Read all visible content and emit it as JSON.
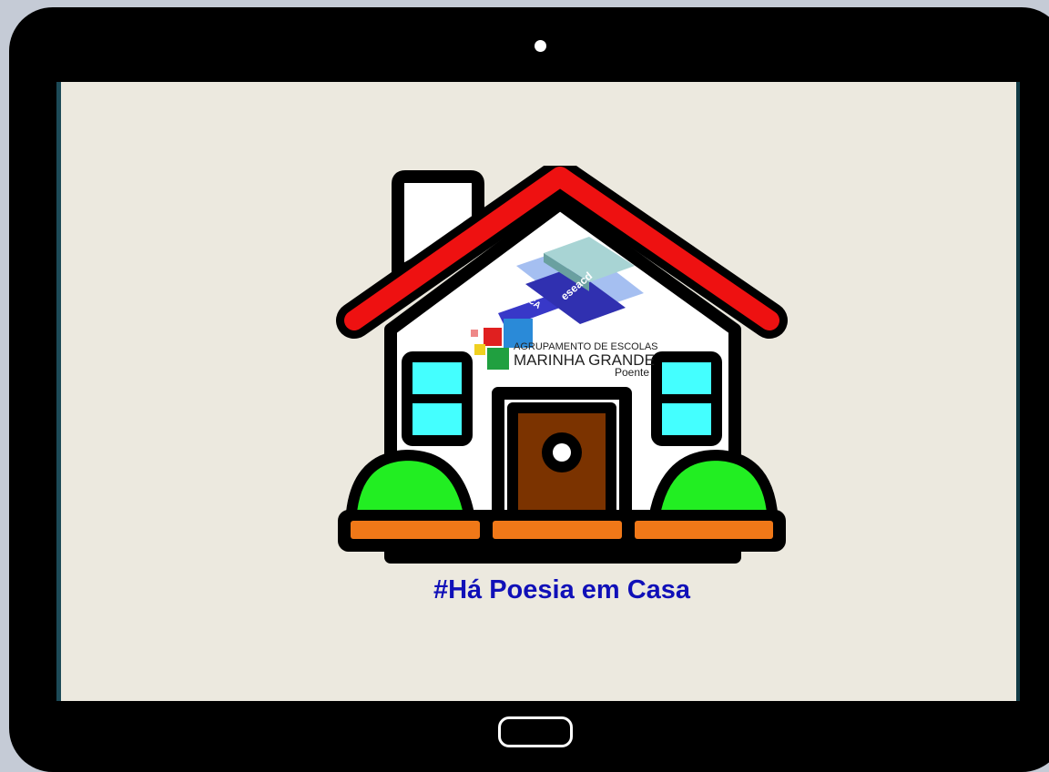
{
  "screen": {
    "logo": {
      "mediateca_label": "MEDIATECA",
      "eseacd_label": "eseacd",
      "line1": "AGRUPAMENTO DE ESCOLAS",
      "line2": "MARINHA GRANDE",
      "line3": "Poente"
    },
    "caption": "#Há Poesia em Casa"
  },
  "colors": {
    "screen_background": "#ece9df",
    "roof": "#ee1111",
    "bushes": "#22ee22",
    "windows": "#44ffff",
    "door": "#7b3300",
    "ground": "#f07818",
    "caption": "#1010b8"
  },
  "icons": {
    "house": "house-illustration",
    "camera": "front-camera-dot",
    "home": "home-button-outline"
  }
}
